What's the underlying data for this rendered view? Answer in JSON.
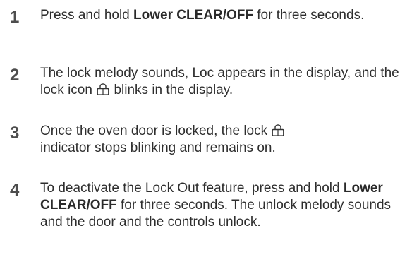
{
  "steps": [
    {
      "number": "1",
      "parts": [
        "Press and hold ",
        "Lower CLEAR/OFF",
        " for three seconds."
      ]
    },
    {
      "number": "2",
      "parts": [
        "The lock melody sounds, Loc appears in the display, and the lock icon ",
        " blinks in the  display."
      ]
    },
    {
      "number": "3",
      "parts": [
        "Once the oven door is locked, the lock ",
        " indicator stops blinking and remains on."
      ]
    },
    {
      "number": "4",
      "parts": [
        "To deactivate the Lock Out feature, press and hold ",
        "Lower CLEAR/OFF",
        " for three seconds. The unlock melody sounds and the door and the controls unlock."
      ]
    }
  ],
  "icons": {
    "lock": "lock-icon"
  }
}
